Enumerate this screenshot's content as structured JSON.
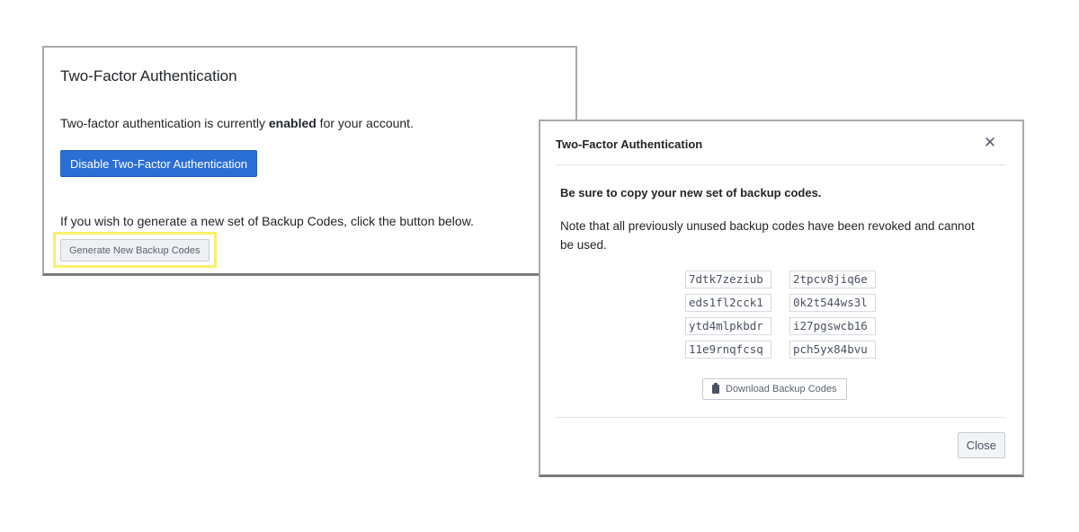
{
  "settings_panel": {
    "title": "Two-Factor Authentication",
    "status_prefix": "Two-factor authentication is currently ",
    "status_value": "enabled",
    "status_suffix": " for your account.",
    "disable_button_label": "Disable Two-Factor Authentication",
    "hint": "If you wish to generate a new set of Backup Codes, click the button below.",
    "generate_button_label": "Generate New Backup Codes",
    "highlight_color": "#f8f06a",
    "primary_color": "#2a6fd6"
  },
  "modal": {
    "title": "Two-Factor Authentication",
    "close_icon": "close-icon",
    "close_glyph": "✕",
    "emphasis": "Be sure to copy your new set of backup codes.",
    "note": "Note that all previously unused backup codes have been revoked and cannot be used.",
    "backup_codes": [
      "7dtk7zeziub",
      "2tpcv8jiq6e",
      "eds1fl2cck1",
      "0k2t544ws3l",
      "ytd4mlpkbdr",
      "i27pgswcb16",
      "11e9rnqfcsq",
      "pch5yx84bvu"
    ],
    "download_icon": "clipboard-icon",
    "download_button_label": "Download Backup Codes",
    "close_button_label": "Close"
  }
}
